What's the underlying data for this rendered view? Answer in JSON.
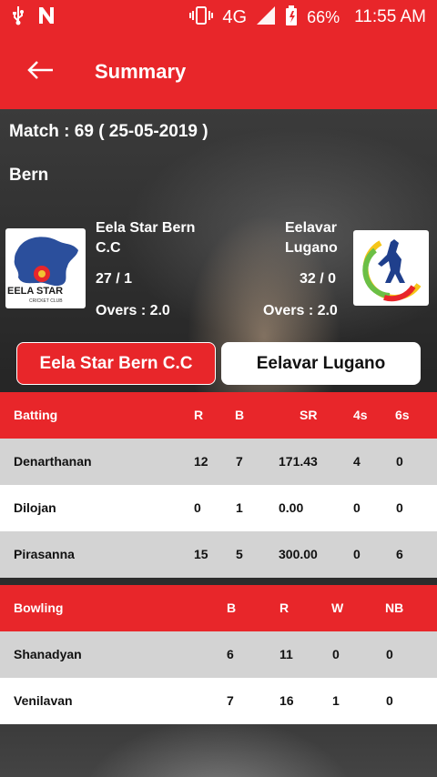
{
  "status_bar": {
    "network": "4G",
    "battery": "66%",
    "time": "11:55 AM"
  },
  "app_bar": {
    "title": "Summary"
  },
  "match": {
    "info": "Match : 69 ( 25-05-2019 )",
    "venue": "Bern"
  },
  "team_a": {
    "name": "Eela Star Bern C.C",
    "score": "27 / 1",
    "overs": "Overs : 2.0",
    "logo_text": "EELA STAR",
    "logo_sub": "CRICKET CLUB"
  },
  "team_b": {
    "name": "Eelavar Lugano",
    "score": "32 / 0",
    "overs": "Overs : 2.0"
  },
  "tabs": [
    "Eela Star Bern C.C",
    "Eelavar Lugano"
  ],
  "batting": {
    "headers": [
      "Batting",
      "R",
      "B",
      "SR",
      "4s",
      "6s"
    ],
    "rows": [
      [
        "Denarthanan",
        "12",
        "7",
        "171.43",
        "4",
        "0"
      ],
      [
        "Dilojan",
        "0",
        "1",
        "0.00",
        "0",
        "0"
      ],
      [
        "Pirasanna",
        "15",
        "5",
        "300.00",
        "0",
        "6"
      ]
    ]
  },
  "bowling": {
    "headers": [
      "Bowling",
      "B",
      "R",
      "W",
      "NB"
    ],
    "rows": [
      [
        "Shanadyan",
        "6",
        "11",
        "0",
        "0"
      ],
      [
        "Venilavan",
        "7",
        "16",
        "1",
        "0"
      ]
    ]
  },
  "colors": {
    "accent": "#e8262a",
    "row_grey": "#d3d3d3"
  },
  "icons": [
    "usb-icon",
    "n-icon",
    "vibrate-icon",
    "signal-icon",
    "battery-icon",
    "back-arrow-icon"
  ]
}
